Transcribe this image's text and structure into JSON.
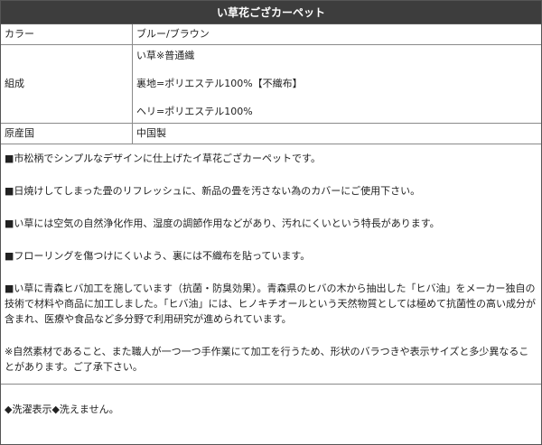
{
  "title": "い草花ござカーペット",
  "spec_rows": {
    "color": {
      "label": "カラー",
      "value": "ブルー/ブラウン"
    },
    "composition": {
      "label": "組成",
      "lines": [
        "い草※普通織",
        "裏地=ポリエステル100%【不織布】",
        "ヘリ=ポリエステル100%"
      ]
    },
    "origin": {
      "label": "原産国",
      "value": "中国製"
    }
  },
  "description": [
    "■市松柄でシンプルなデザインに仕上げたイ草花ござカーペットです。",
    "■日焼けしてしまった畳のリフレッシュに、新品の畳を汚さない為のカバーにご使用下さい。",
    "■い草には空気の自然浄化作用、湿度の調節作用などがあり、汚れにくいという特長があります。",
    "■フローリングを傷つけにくいよう、裏には不織布を貼っています。",
    "■い草に青森ヒバ加工を施しています（抗菌・防臭効果）。青森県のヒバの木から抽出した「ヒバ油」をメーカー独自の技術で材料や商品に加工しました。「ヒバ油」には、ヒノキチオールという天然物質としては極めて抗菌性の高い成分が含まれ、医療や食品など多分野で利用研究が進められています。",
    "※自然素材であること、また職人が一つ一つ手作業にて加工を行うため、形状のバラつきや表示サイズと多少異なることがあります。ご了承下さい。"
  ],
  "care_note": "◆洗濯表示◆洗えません。"
}
